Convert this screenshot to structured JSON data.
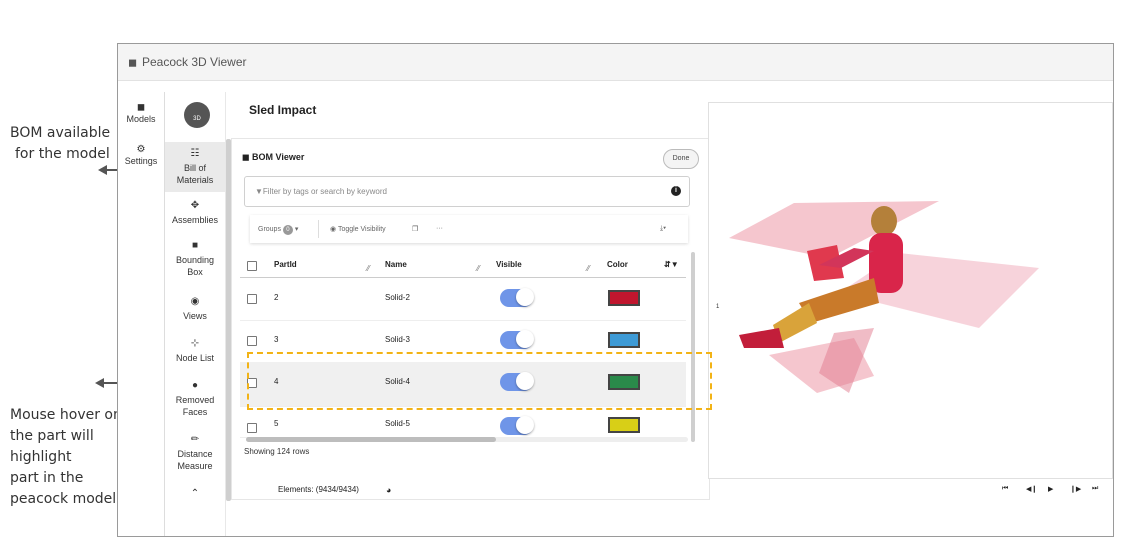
{
  "annotations": {
    "bom_note": [
      "BOM available",
      "for the model"
    ],
    "hover_note": [
      "Mouse hover on",
      "the part will",
      "highlight",
      "part in the",
      "peacock model"
    ]
  },
  "window": {
    "title": "Peacock 3D Viewer",
    "title_icon": "cube-icon"
  },
  "left_nav": [
    {
      "label": "Models",
      "icon": "cube-icon"
    },
    {
      "label": "Settings",
      "icon": "gear-icon"
    }
  ],
  "logo": {
    "text": "3D"
  },
  "tools": [
    {
      "label": "Bill of Materials",
      "icon": "sitemap-icon",
      "active": true
    },
    {
      "label": "Assemblies",
      "icon": "move-icon"
    },
    {
      "label": "Bounding Box",
      "icon": "box-icon"
    },
    {
      "label": "Views",
      "icon": "eye-icon"
    },
    {
      "label": "Node List",
      "icon": "share-icon"
    },
    {
      "label": "Removed Faces",
      "icon": "eraser-icon"
    },
    {
      "label": "Distance Measure",
      "icon": "pencil-icon"
    },
    {
      "label": "",
      "icon": "chevron-double-up-icon"
    }
  ],
  "model": {
    "title": "Sled Impact"
  },
  "bom": {
    "title": "BOM Viewer",
    "done_label": "Done",
    "search_placeholder": "Filter by tags or search by keyword",
    "toolbar": {
      "groups_label": "Groups",
      "groups_count": "0",
      "toggle_label": "Toggle Visibility",
      "more_label": "···"
    },
    "columns": [
      "PartId",
      "Name",
      "Visible",
      "Color"
    ],
    "rows": [
      {
        "id": "2",
        "name": "Solid-2",
        "visible": true,
        "color": "#c0162e"
      },
      {
        "id": "3",
        "name": "Solid-3",
        "visible": true,
        "color": "#3d9ad6"
      },
      {
        "id": "4",
        "name": "Solid-4",
        "visible": true,
        "color": "#2a8a4a",
        "hover": true
      },
      {
        "id": "5",
        "name": "Solid-5",
        "visible": true,
        "color": "#d8cf17"
      }
    ],
    "row_count": "Showing 124 rows"
  },
  "footer": {
    "elements": "Elements: (9434/9434)"
  },
  "viewer": {
    "axis_label": "1"
  },
  "colors": {
    "accent_toggle": "#6f95e8",
    "highlight": "#f2b316"
  }
}
